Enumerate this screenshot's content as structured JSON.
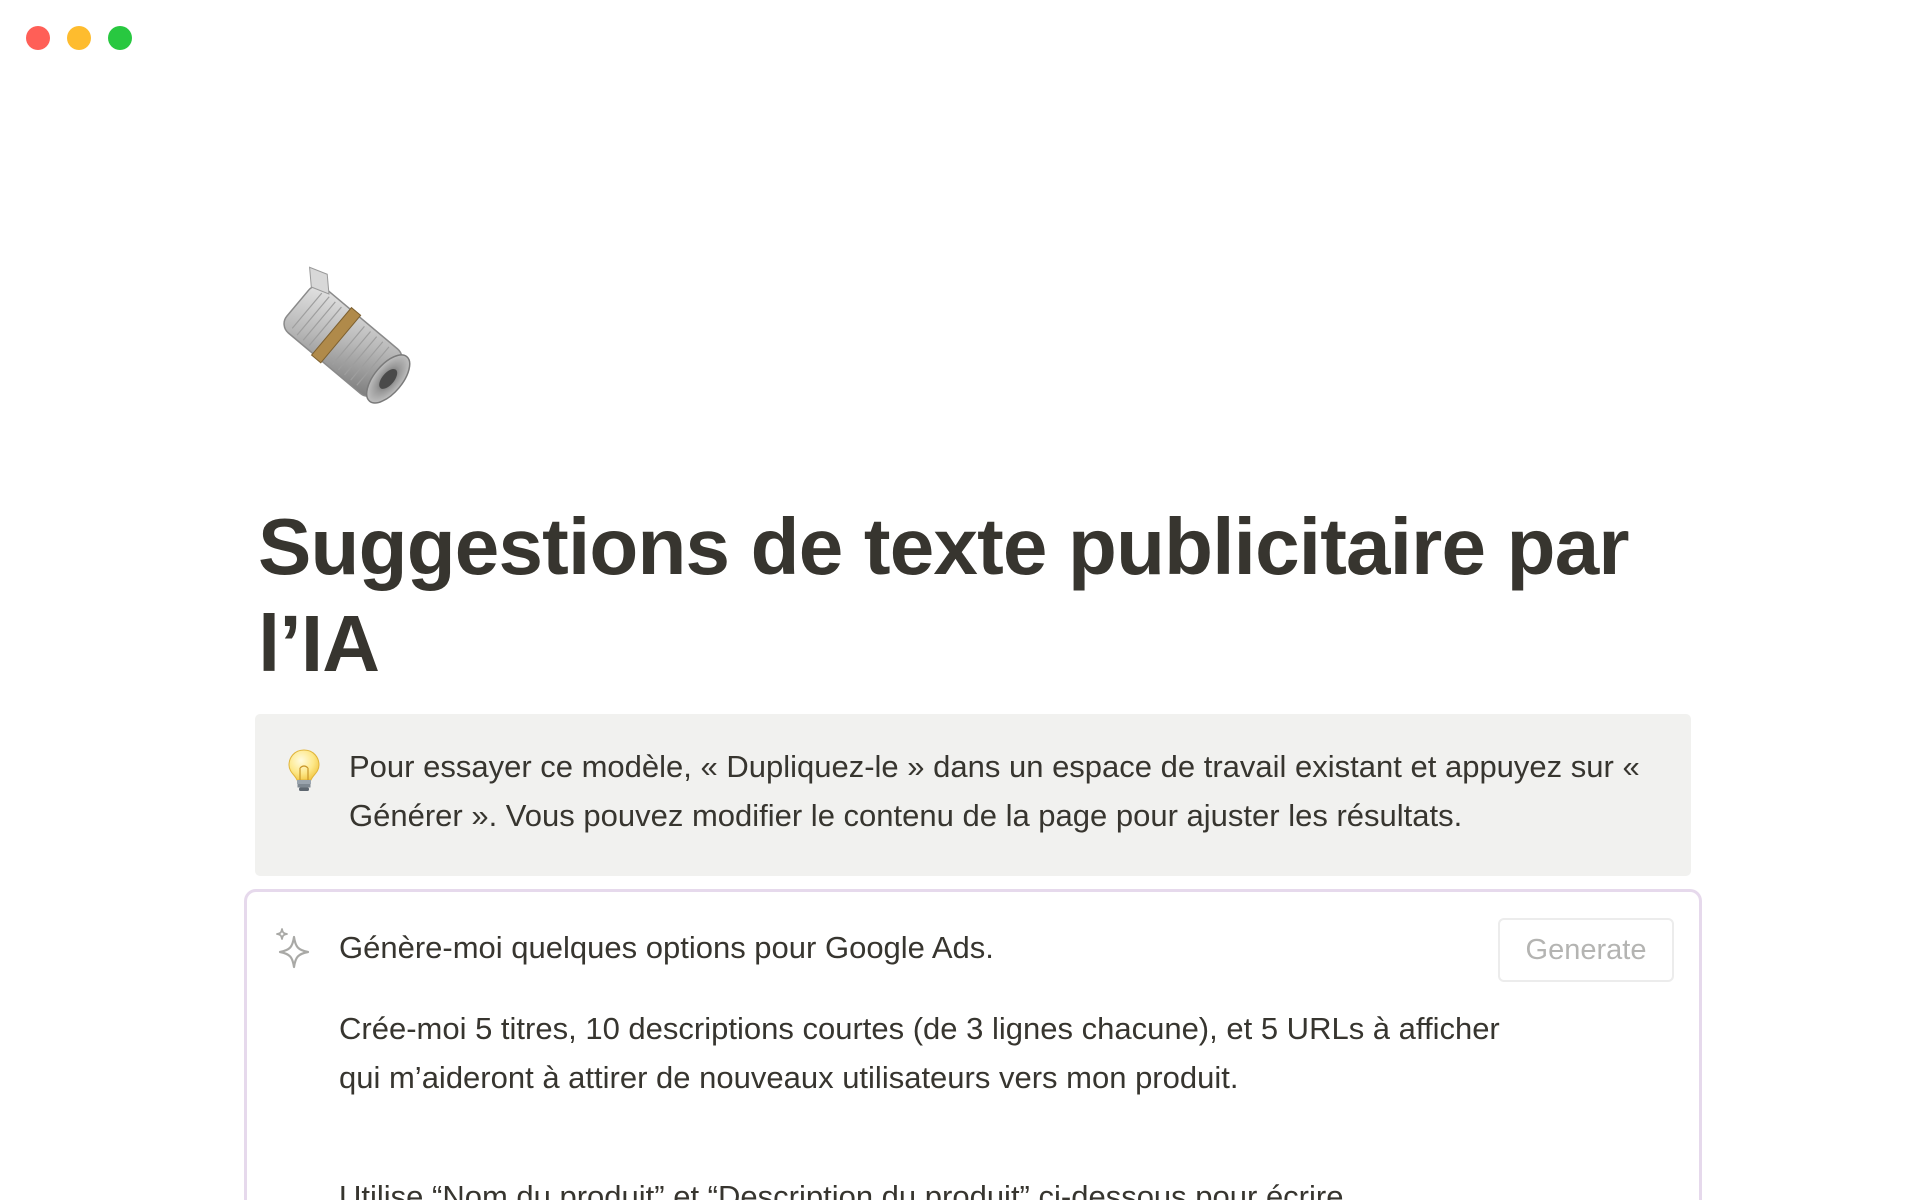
{
  "window": {
    "controls": [
      "close",
      "minimize",
      "zoom"
    ]
  },
  "page": {
    "icon": "rolled-newspaper-icon",
    "title": "Suggestions de texte publicitaire par l’IA"
  },
  "callout": {
    "icon": "lightbulb-icon",
    "text": "Pour essayer ce modèle, « Dupliquez-le » dans un espace de travail existant et appuyez sur « Générer ». Vous pouvez modifier le contenu de la page pour ajuster les résultats."
  },
  "ai_block": {
    "icon": "sparkle-icon",
    "heading": "Génère-moi quelques options pour Google Ads.",
    "generate_label": "Generate",
    "paragraphs": [
      "Crée-moi 5 titres, 10 descriptions courtes (de 3 lignes chacune), et 5 URLs à afficher qui m’aideront à attirer de nouveaux utilisateurs vers mon produit.",
      "Utilise “Nom du produit” et “Description du produit” ci-dessous pour écrire"
    ]
  }
}
